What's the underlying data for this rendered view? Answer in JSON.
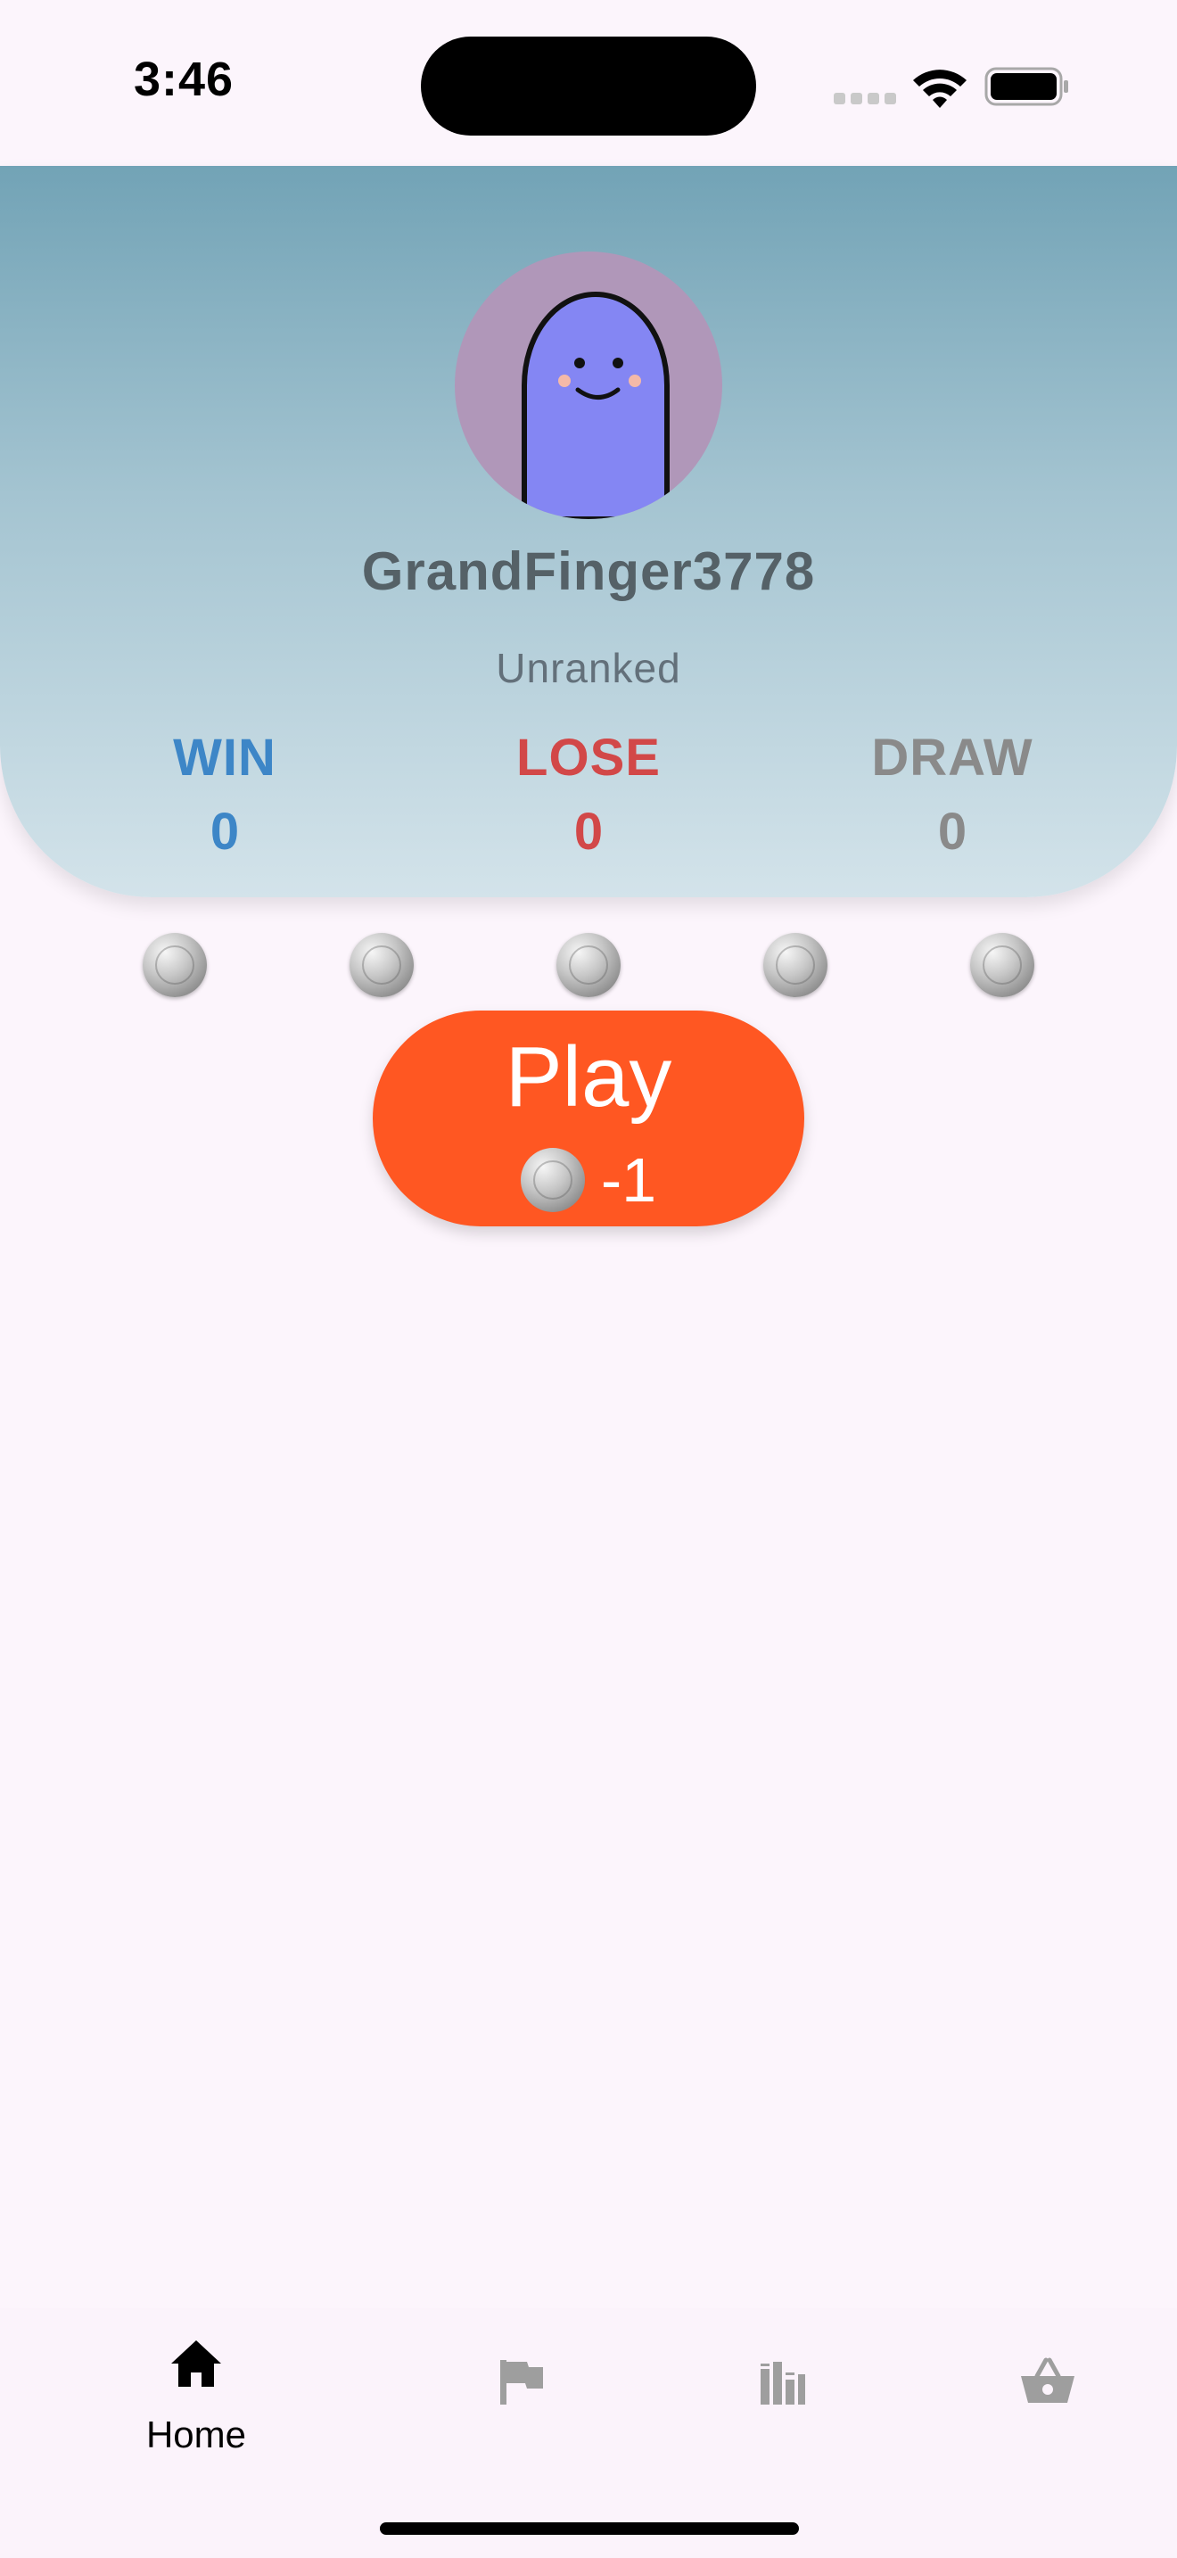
{
  "status_bar": {
    "time": "3:46"
  },
  "profile": {
    "username": "GrandFinger3778",
    "rank": "Unranked",
    "avatar_colors": {
      "background": "#b097b9",
      "body": "#8486f3"
    },
    "stats": {
      "win_label": "WIN",
      "win_value": "0",
      "lose_label": "LOSE",
      "lose_value": "0",
      "draw_label": "DRAW",
      "draw_value": "0"
    }
  },
  "coins": {
    "count": 5,
    "icon": "silver-coin-icon"
  },
  "play": {
    "label": "Play",
    "cost": "-1"
  },
  "nav": {
    "items": [
      {
        "id": "home",
        "label": "Home",
        "icon": "home-icon",
        "active": true
      },
      {
        "id": "challenges",
        "label": "",
        "icon": "flag-icon",
        "active": false
      },
      {
        "id": "leaderboard",
        "label": "",
        "icon": "leaderboard-icon",
        "active": false
      },
      {
        "id": "shop",
        "label": "",
        "icon": "basket-icon",
        "active": false
      }
    ]
  },
  "colors": {
    "play_button": "#ff5722",
    "win": "#3d86c7",
    "lose": "#d24848",
    "draw": "#8a8a8a",
    "nav_active": "#000000",
    "nav_inactive": "#9e9e9e"
  }
}
